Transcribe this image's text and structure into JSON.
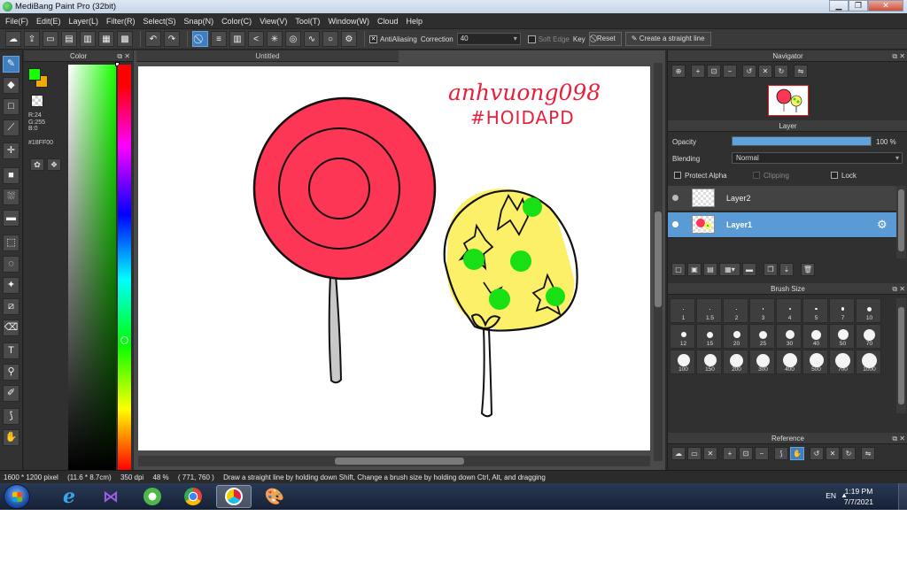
{
  "window": {
    "title": "MediBang Paint Pro (32bit)",
    "minimize": "▁",
    "maximize": "❐",
    "close": "✕"
  },
  "menu": [
    "File(F)",
    "Edit(E)",
    "Layer(L)",
    "Filter(R)",
    "Select(S)",
    "Snap(N)",
    "Color(C)",
    "View(V)",
    "Tool(T)",
    "Window(W)",
    "Cloud",
    "Help"
  ],
  "toolbar": {
    "antialiasing_label": "AntiAliasing",
    "antialiasing_checked": "✕",
    "correction_label": "Correction",
    "correction_value": "40",
    "soft_edge_label": "Soft Edge",
    "key_label": "Key",
    "reset_label": "Reset",
    "straight_line_label": "Create a straight line"
  },
  "color_panel": {
    "title": "Color",
    "r": "R:24",
    "g": "G:255",
    "b": "B:0",
    "hex": "#18FF00",
    "fg_color": "#18ff00",
    "bg_color": "#f2a900"
  },
  "document": {
    "tab_title": "Untitled"
  },
  "artwork": {
    "signature_line1": "anhvuong098",
    "signature_line2": "#HOIDAPD"
  },
  "navigator": {
    "title": "Navigator"
  },
  "layer_panel": {
    "title": "Layer",
    "opacity_label": "Opacity",
    "opacity_value": "100 %",
    "opacity_level": 1.0,
    "blending_label": "Blending",
    "blending_value": "Normal",
    "protect_alpha_label": "Protect Alpha",
    "clipping_label": "Clipping",
    "lock_label": "Lock",
    "layers": [
      {
        "name": "Layer2",
        "selected": false
      },
      {
        "name": "Layer1",
        "selected": true
      }
    ]
  },
  "brush_size": {
    "title": "Brush Size",
    "sizes": [
      "1",
      "1.5",
      "2",
      "3",
      "4",
      "5",
      "7",
      "10",
      "12",
      "15",
      "20",
      "25",
      "30",
      "40",
      "50",
      "70",
      "100",
      "150",
      "200",
      "300",
      "400",
      "500",
      "700",
      "1000"
    ]
  },
  "reference": {
    "title": "Reference"
  },
  "status": {
    "dimensions": "1600 * 1200 pixel",
    "physical": "(11.6 * 8.7cm)",
    "dpi": "350 dpi",
    "zoom": "48 %",
    "cursor": "( 771, 760 )",
    "hint": "Draw a straight line by holding down Shift, Change a brush size by holding down Ctrl, Alt, and dragging"
  },
  "taskbar": {
    "language": "EN",
    "time": "1:19 PM",
    "date": "7/7/2021"
  }
}
